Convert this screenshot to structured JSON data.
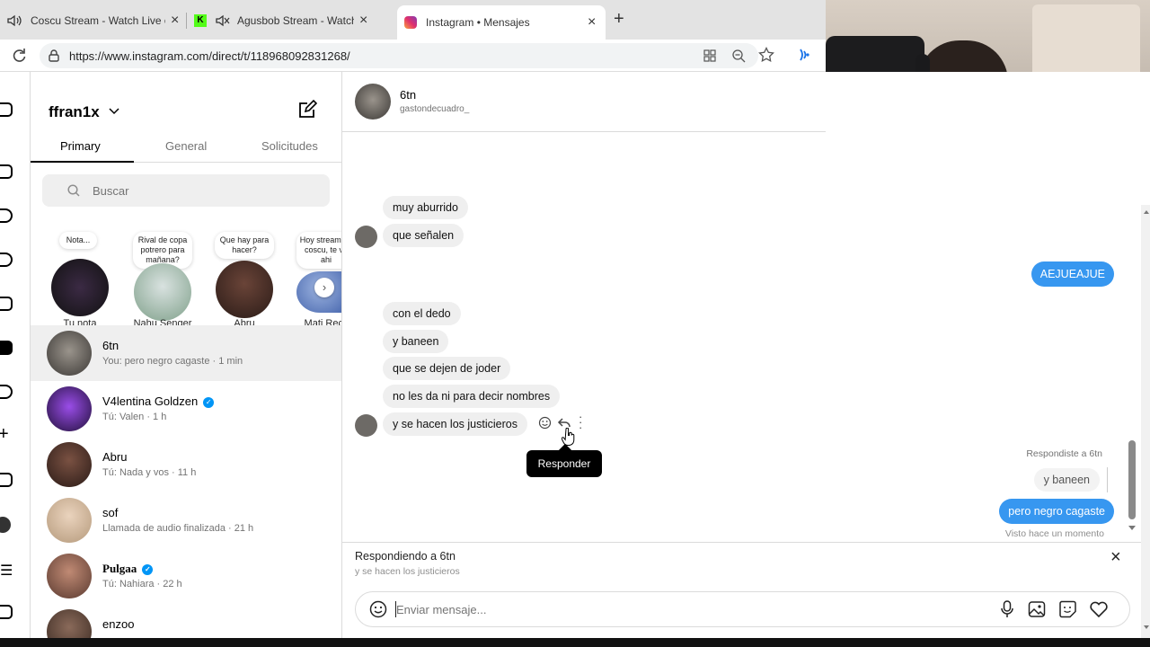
{
  "browser": {
    "tabs": [
      {
        "label": "Coscu Stream - Watch Live o",
        "icon": "speaker-icon"
      },
      {
        "label": "Agusbob Stream - Watch Liv",
        "icon": "kick-logo-icon"
      },
      {
        "label": "Instagram • Mensajes",
        "icon": "instagram-logo-icon"
      }
    ],
    "url": "https://www.instagram.com/direct/t/118968092831268/"
  },
  "sidebar": {
    "username": "ffran1x",
    "tabs": [
      "Primary",
      "General",
      "Solicitudes"
    ],
    "search_placeholder": "Buscar",
    "notes": [
      {
        "bubble": "Nota...",
        "name": "Tu nota"
      },
      {
        "bubble": "Rival de copa potrero para mañana?",
        "name": "Nahu Senger"
      },
      {
        "bubble": "Que hay para hacer?",
        "name": "Abru"
      },
      {
        "bubble": "Hoy stream de coscu, te ve ahi",
        "name": "Mati Recc"
      }
    ],
    "conversations": [
      {
        "name": "6tn",
        "preview": "You: pero negro cagaste · 1 min",
        "verified": false
      },
      {
        "name": "V4lentina Goldzen",
        "preview": "Tú: Valen · 1 h",
        "verified": true
      },
      {
        "name": "Abru",
        "preview": "Tú: Nada y vos · 11 h",
        "verified": false
      },
      {
        "name": "sof",
        "preview": "Llamada de audio finalizada · 21 h",
        "verified": false
      },
      {
        "name": "Pulgaa",
        "preview": "Tú: Nahiara · 22 h",
        "verified": true
      },
      {
        "name": "enzoo",
        "preview": "",
        "verified": false
      }
    ]
  },
  "chat": {
    "name": "6tn",
    "handle": "gastondecuadro_",
    "messages_in_1": [
      "muy aburrido",
      "que señalen"
    ],
    "message_out_1": "AEJUEAJUE",
    "messages_in_2": [
      "con el dedo",
      "y baneen",
      "que se dejen de joder",
      "no les da ni para decir nombres",
      "y se hacen los justicieros"
    ],
    "tooltip": "Responder",
    "replied_label": "Respondiste a 6tn",
    "replied_quote": "y baneen",
    "message_out_2": "pero negro cagaste",
    "seen": "Visto hace un momento",
    "replying_to": "Respondiendo a 6tn",
    "replying_quote": "y se hacen los justicieros",
    "composer_placeholder": "Enviar mensaje..."
  },
  "colors": {
    "accent": "#3797f0",
    "verified": "#0095f6"
  }
}
